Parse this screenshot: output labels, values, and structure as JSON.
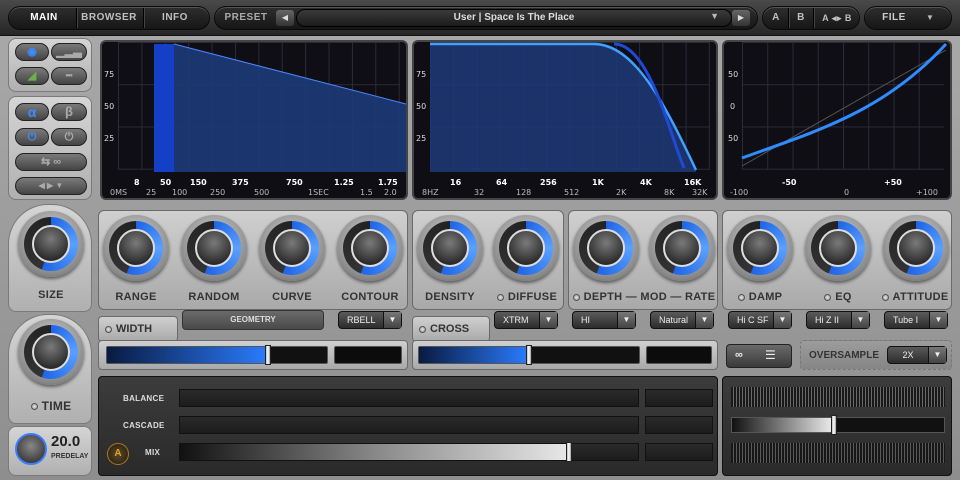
{
  "tabs": {
    "main": "MAIN",
    "browser": "BROWSER",
    "info": "INFO"
  },
  "preset": {
    "label": "PRESET",
    "name": "User | Space Is The Place"
  },
  "ab": {
    "a": "A",
    "b": "B",
    "swap": "A ◂▸ B",
    "file": "FILE"
  },
  "left": {
    "alpha": "α",
    "beta": "β",
    "size_label": "SIZE",
    "time_label": "TIME",
    "predelay_value": "20.0",
    "predelay_label": "PREDELAY"
  },
  "displays": {
    "d1": {
      "y": [
        "75",
        "50",
        "25"
      ],
      "xtop": [
        "8",
        "50",
        "150",
        "375",
        "750",
        "1.25",
        "1.75"
      ],
      "xbot": [
        "0MS",
        "25",
        "100",
        "250",
        "500",
        "1SEC",
        "1.5",
        "2.0"
      ]
    },
    "d2": {
      "y": [
        "75",
        "50",
        "25"
      ],
      "xtop": [
        "16",
        "64",
        "256",
        "1K",
        "4K",
        "16K"
      ],
      "xbot": [
        "8HZ",
        "32",
        "128",
        "512",
        "2K",
        "8K",
        "32K"
      ]
    },
    "d3": {
      "y": [
        "50",
        "0",
        "50"
      ],
      "xtop": [
        "-50",
        "+50"
      ],
      "xbot": [
        "-100",
        "0",
        "+100"
      ]
    }
  },
  "knobs": {
    "range": "RANGE",
    "random": "RANDOM",
    "curve": "CURVE",
    "contour": "CONTOUR",
    "density": "DENSITY",
    "diffuse": "DIFFUSE",
    "depth_mod_rate": "DEPTH — MOD — RATE",
    "damp": "DAMP",
    "eq": "EQ",
    "attitude": "ATTITUDE"
  },
  "controls": {
    "geometry": "GEOMETRY",
    "rbell": "RBELL",
    "xtrm": "XTRM",
    "hi": "HI",
    "natural": "Natural",
    "hicsf": "Hi C SF",
    "hizii": "Hi Z II",
    "tube": "Tube I",
    "width": "WIDTH",
    "cross": "CROSS"
  },
  "oversample": {
    "label": "OVERSAMPLE",
    "value": "2X"
  },
  "levels": {
    "width": 0.73,
    "cross": 0.5,
    "mix": 0.85,
    "right_fader": 0.48
  },
  "bottom": {
    "balance": "BALANCE",
    "cascade": "CASCADE",
    "mix": "MIX"
  },
  "colors": {
    "accent": "#1e64e6",
    "accent_light": "#5aa0ff"
  }
}
